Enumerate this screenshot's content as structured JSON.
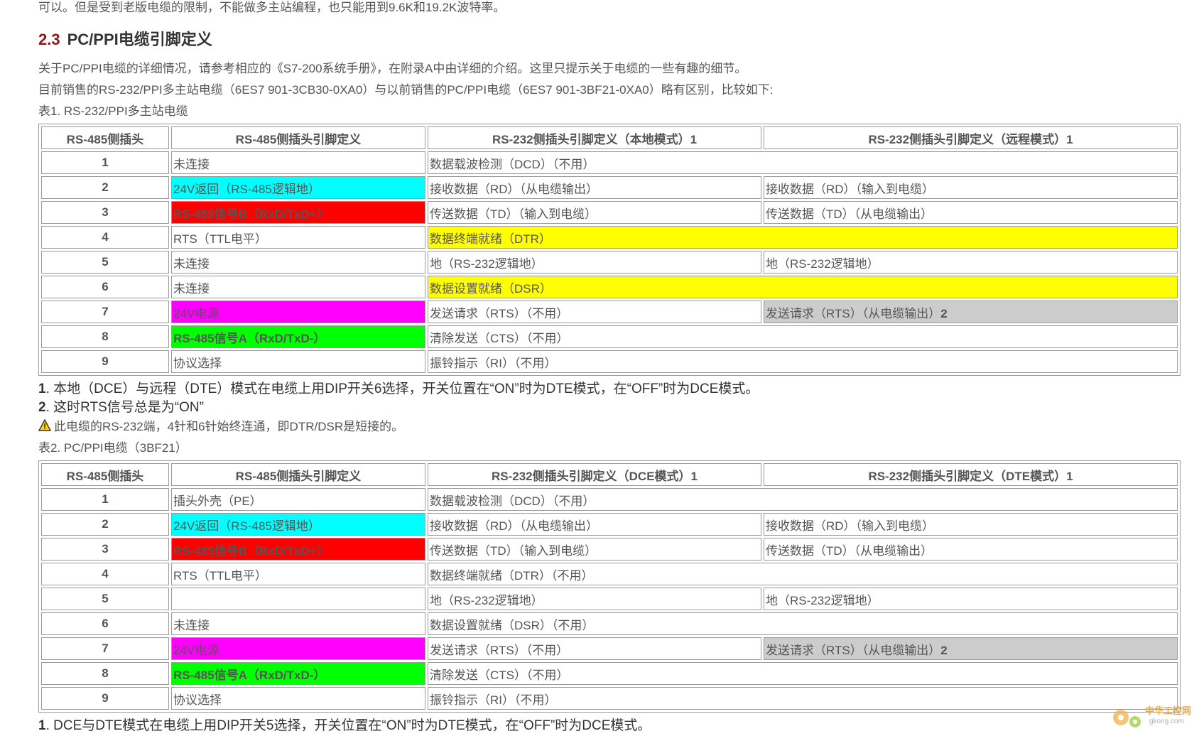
{
  "intro": "可以。但是受到老版电缆的限制，不能做多主站编程，也只能用到9.6K和19.2K波特率。",
  "heading": {
    "number": "2.3",
    "title": "PC/PPI电缆引脚定义"
  },
  "paragraph1": "关于PC/PPI电缆的详细情况，请参考相应的《S7-200系统手册》，在附录A中由详细的介绍。这里只提示关于电缆的一些有趣的细节。",
  "paragraph2": "目前销售的RS-232/PPI多主站电缆（6ES7 901-3CB30-0XA0）与以前销售的PC/PPI电缆（6ES7 901-3BF21-0XA0）略有区别，比较如下:",
  "table1": {
    "caption": "表1. RS-232/PPI多主站电缆",
    "headers": [
      "RS-485侧插头",
      "RS-485侧插头引脚定义",
      "RS-232侧插头引脚定义（本地模式）1",
      "RS-232侧插头引脚定义（远程模式）1"
    ],
    "rows": [
      {
        "pin": "1",
        "def485": "未连接",
        "c485": "white",
        "local": "数据载波检测（DCD）（不用）",
        "cl": "white",
        "remote": null,
        "cr": "white"
      },
      {
        "pin": "2",
        "def485": "24V返回（RS-485逻辑地）",
        "c485": "cyan",
        "local": "接收数据（RD）（从电缆输出）",
        "cl": "white",
        "remote": "接收数据（RD）（输入到电缆）",
        "cr": "white"
      },
      {
        "pin": "3",
        "def485": "RS-485信号B（RxD/TxD+）",
        "c485": "red",
        "local": "传送数据（TD）（输入到电缆）",
        "cl": "white",
        "remote": "传送数据（TD）（从电缆输出）",
        "cr": "white"
      },
      {
        "pin": "4",
        "def485": "RTS（TTL电平）",
        "c485": "white",
        "local": "数据终端就绪（DTR）",
        "cl": "yellow",
        "remote": null,
        "cr": "yellow"
      },
      {
        "pin": "5",
        "def485": "未连接",
        "c485": "white",
        "local": "地（RS-232逻辑地）",
        "cl": "white",
        "remote": "地（RS-232逻辑地）",
        "cr": "white"
      },
      {
        "pin": "6",
        "def485": "未连接",
        "c485": "white",
        "local": "数据设置就绪（DSR）",
        "cl": "yellow",
        "remote": null,
        "cr": "yellow"
      },
      {
        "pin": "7",
        "def485": "24V电源",
        "c485": "magenta",
        "local": "发送请求（RTS）（不用）",
        "cl": "white",
        "remote": "发送请求（RTS）（从电缆输出）",
        "remote_sup": "2",
        "cr": "gray"
      },
      {
        "pin": "8",
        "def485": "RS-485信号A（RxD/TxD-）",
        "c485": "green",
        "local": "清除发送（CTS）（不用）",
        "cl": "white",
        "remote": null,
        "cr": "white"
      },
      {
        "pin": "9",
        "def485": "协议选择",
        "c485": "white",
        "local": "振铃指示（RI）（不用）",
        "cl": "white",
        "remote": null,
        "cr": "white"
      }
    ]
  },
  "notes1": [
    {
      "num": "1",
      "text": ". 本地（DCE）与远程（DTE）模式在电缆上用DIP开关6选择，开关位置在“ON”时为DTE模式，在“OFF”时为DCE模式。"
    },
    {
      "num": "2",
      "text": ". 这时RTS信号总是为“ON”"
    }
  ],
  "warning": "此电缆的RS-232端，4针和6针始终连通，即DTR/DSR是短接的。",
  "table2": {
    "caption": "表2. PC/PPI电缆（3BF21）",
    "headers": [
      "RS-485侧插头",
      "RS-485侧插头引脚定义",
      "RS-232侧插头引脚定义（DCE模式）1",
      "RS-232侧插头引脚定义（DTE模式）1"
    ],
    "rows": [
      {
        "pin": "1",
        "def485": "插头外壳（PE）",
        "c485": "white",
        "local": "数据载波检测（DCD）（不用）",
        "cl": "white",
        "remote": null,
        "cr": "white"
      },
      {
        "pin": "2",
        "def485": "24V返回（RS-485逻辑地）",
        "c485": "cyan",
        "local": "接收数据（RD）（从电缆输出）",
        "cl": "white",
        "remote": "接收数据（RD）（输入到电缆）",
        "cr": "white"
      },
      {
        "pin": "3",
        "def485": "RS-485信号B（RxD/TxD+）",
        "c485": "red",
        "local": "传送数据（TD）（输入到电缆）",
        "cl": "white",
        "remote": "传送数据（TD）（从电缆输出）",
        "cr": "white"
      },
      {
        "pin": "4",
        "def485": "RTS（TTL电平）",
        "c485": "white",
        "local": "数据终端就绪（DTR）（不用）",
        "cl": "white",
        "remote": null,
        "cr": "white"
      },
      {
        "pin": "5",
        "def485": "",
        "c485": "white",
        "local": "地（RS-232逻辑地）",
        "cl": "white",
        "remote": "地（RS-232逻辑地）",
        "cr": "white"
      },
      {
        "pin": "6",
        "def485": "未连接",
        "c485": "white",
        "local": "数据设置就绪（DSR）（不用）",
        "cl": "white",
        "remote": null,
        "cr": "white"
      },
      {
        "pin": "7",
        "def485": "24V电源",
        "c485": "magenta",
        "local": "发送请求（RTS）（不用）",
        "cl": "white",
        "remote": "发送请求（RTS）（从电缆输出）",
        "remote_sup": "2",
        "cr": "gray"
      },
      {
        "pin": "8",
        "def485": "RS-485信号A（RxD/TxD-）",
        "c485": "green",
        "local": "清除发送（CTS）（不用）",
        "cl": "white",
        "remote": null,
        "cr": "white"
      },
      {
        "pin": "9",
        "def485": "协议选择",
        "c485": "white",
        "local": "振铃指示（RI）（不用）",
        "cl": "white",
        "remote": null,
        "cr": "white"
      }
    ]
  },
  "note3": {
    "num": "1",
    "text": ". DCE与DTE模式在电缆上用DIP开关5选择，开关位置在“ON”时为DTE模式，在“OFF”时为DCE模式。"
  },
  "watermark": {
    "line1": "中华工控网",
    "line2": "gkong.com"
  }
}
